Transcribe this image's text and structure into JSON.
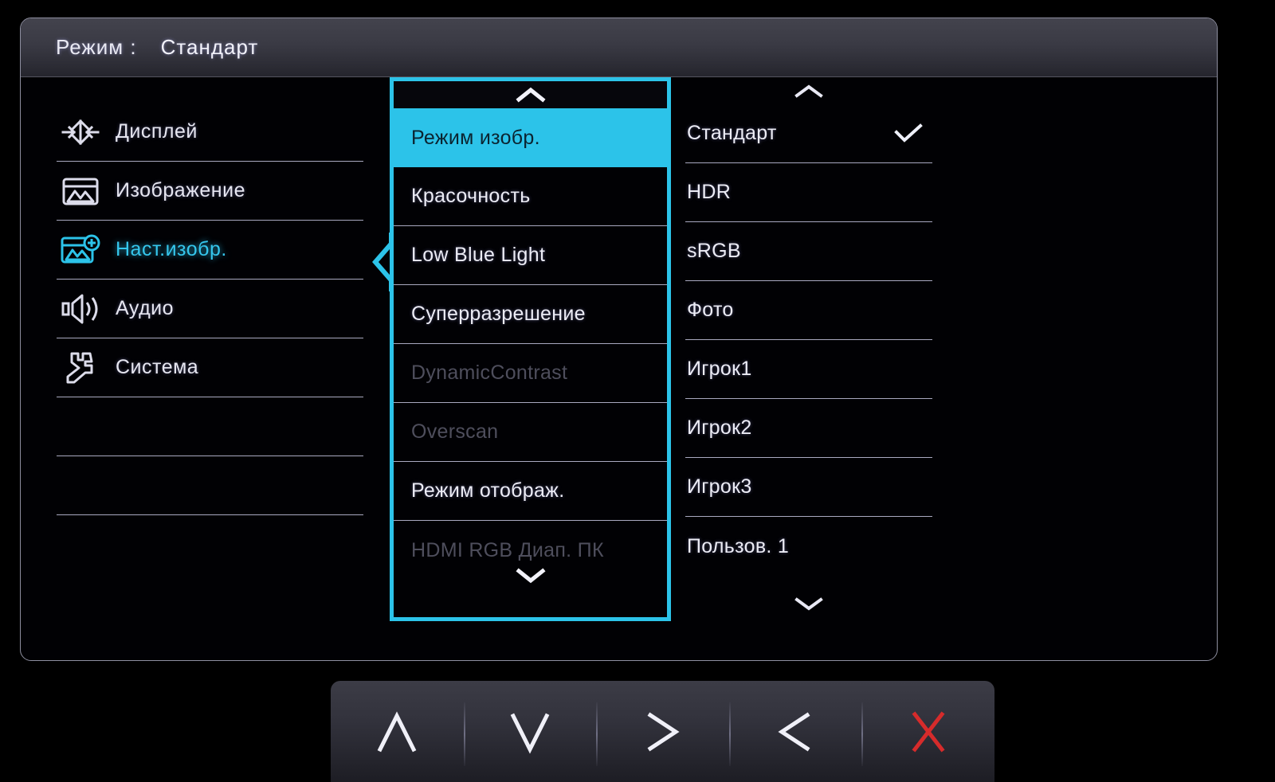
{
  "header": {
    "mode_label": "Режим :",
    "mode_value": "Стандарт"
  },
  "colors": {
    "accent_cyan": "#2CC3E9",
    "text": "#ECECF5",
    "disabled_text": "#4E4E5C",
    "divider": "#A9A9C0",
    "close_red": "#D62B2B",
    "panel_bg": "#010104",
    "header_bg": "#3A3A44"
  },
  "sidebar": {
    "items": [
      {
        "label": "Дисплей",
        "icon": "display-resize-icon",
        "active": false
      },
      {
        "label": "Изображение",
        "icon": "picture-icon",
        "active": false
      },
      {
        "label": "Наст.изобр.",
        "icon": "picture-plus-icon",
        "active": true
      },
      {
        "label": "Аудио",
        "icon": "speaker-icon",
        "active": false
      },
      {
        "label": "Система",
        "icon": "wrench-icon",
        "active": false
      },
      {
        "label": "",
        "icon": "",
        "active": false
      },
      {
        "label": "",
        "icon": "",
        "active": false
      }
    ]
  },
  "middle_column": {
    "scroll_up_icon": "chevron-up-icon",
    "scroll_down_icon": "chevron-down-icon",
    "items": [
      {
        "label": "Режим изобр.",
        "selected": true,
        "disabled": false
      },
      {
        "label": "Красочность",
        "selected": false,
        "disabled": false
      },
      {
        "label": "Low Blue Light",
        "selected": false,
        "disabled": false
      },
      {
        "label": "Суперразрешение",
        "selected": false,
        "disabled": false
      },
      {
        "label": "DynamicContrast",
        "selected": false,
        "disabled": true
      },
      {
        "label": "Overscan",
        "selected": false,
        "disabled": true
      },
      {
        "label": "Режим отображ.",
        "selected": false,
        "disabled": false
      },
      {
        "label": "HDMI RGB Диап. ПК",
        "selected": false,
        "disabled": true
      }
    ]
  },
  "right_column": {
    "scroll_up_icon": "chevron-up-icon",
    "scroll_down_icon": "chevron-down-icon",
    "checked_icon": "checkmark-icon",
    "items": [
      {
        "label": "Стандарт",
        "checked": true
      },
      {
        "label": "HDR",
        "checked": false
      },
      {
        "label": "sRGB",
        "checked": false
      },
      {
        "label": "Фото",
        "checked": false
      },
      {
        "label": "Игрок1",
        "checked": false
      },
      {
        "label": "Игрок2",
        "checked": false
      },
      {
        "label": "Игрок3",
        "checked": false
      },
      {
        "label": "Пользов. 1",
        "checked": false
      }
    ]
  },
  "toolbar": {
    "buttons": [
      {
        "name": "up-button",
        "icon": "chevron-up-icon",
        "glyph": "∧",
        "color": "#F0F0F8"
      },
      {
        "name": "down-button",
        "icon": "chevron-down-icon",
        "glyph": "∨",
        "color": "#F0F0F8"
      },
      {
        "name": "right-button",
        "icon": "chevron-right-icon",
        "glyph": ">",
        "color": "#F0F0F8"
      },
      {
        "name": "left-button",
        "icon": "chevron-left-icon",
        "glyph": "<",
        "color": "#F0F0F8"
      },
      {
        "name": "exit-button",
        "icon": "close-x-icon",
        "glyph": "✕",
        "color": "#D62B2B"
      }
    ]
  }
}
